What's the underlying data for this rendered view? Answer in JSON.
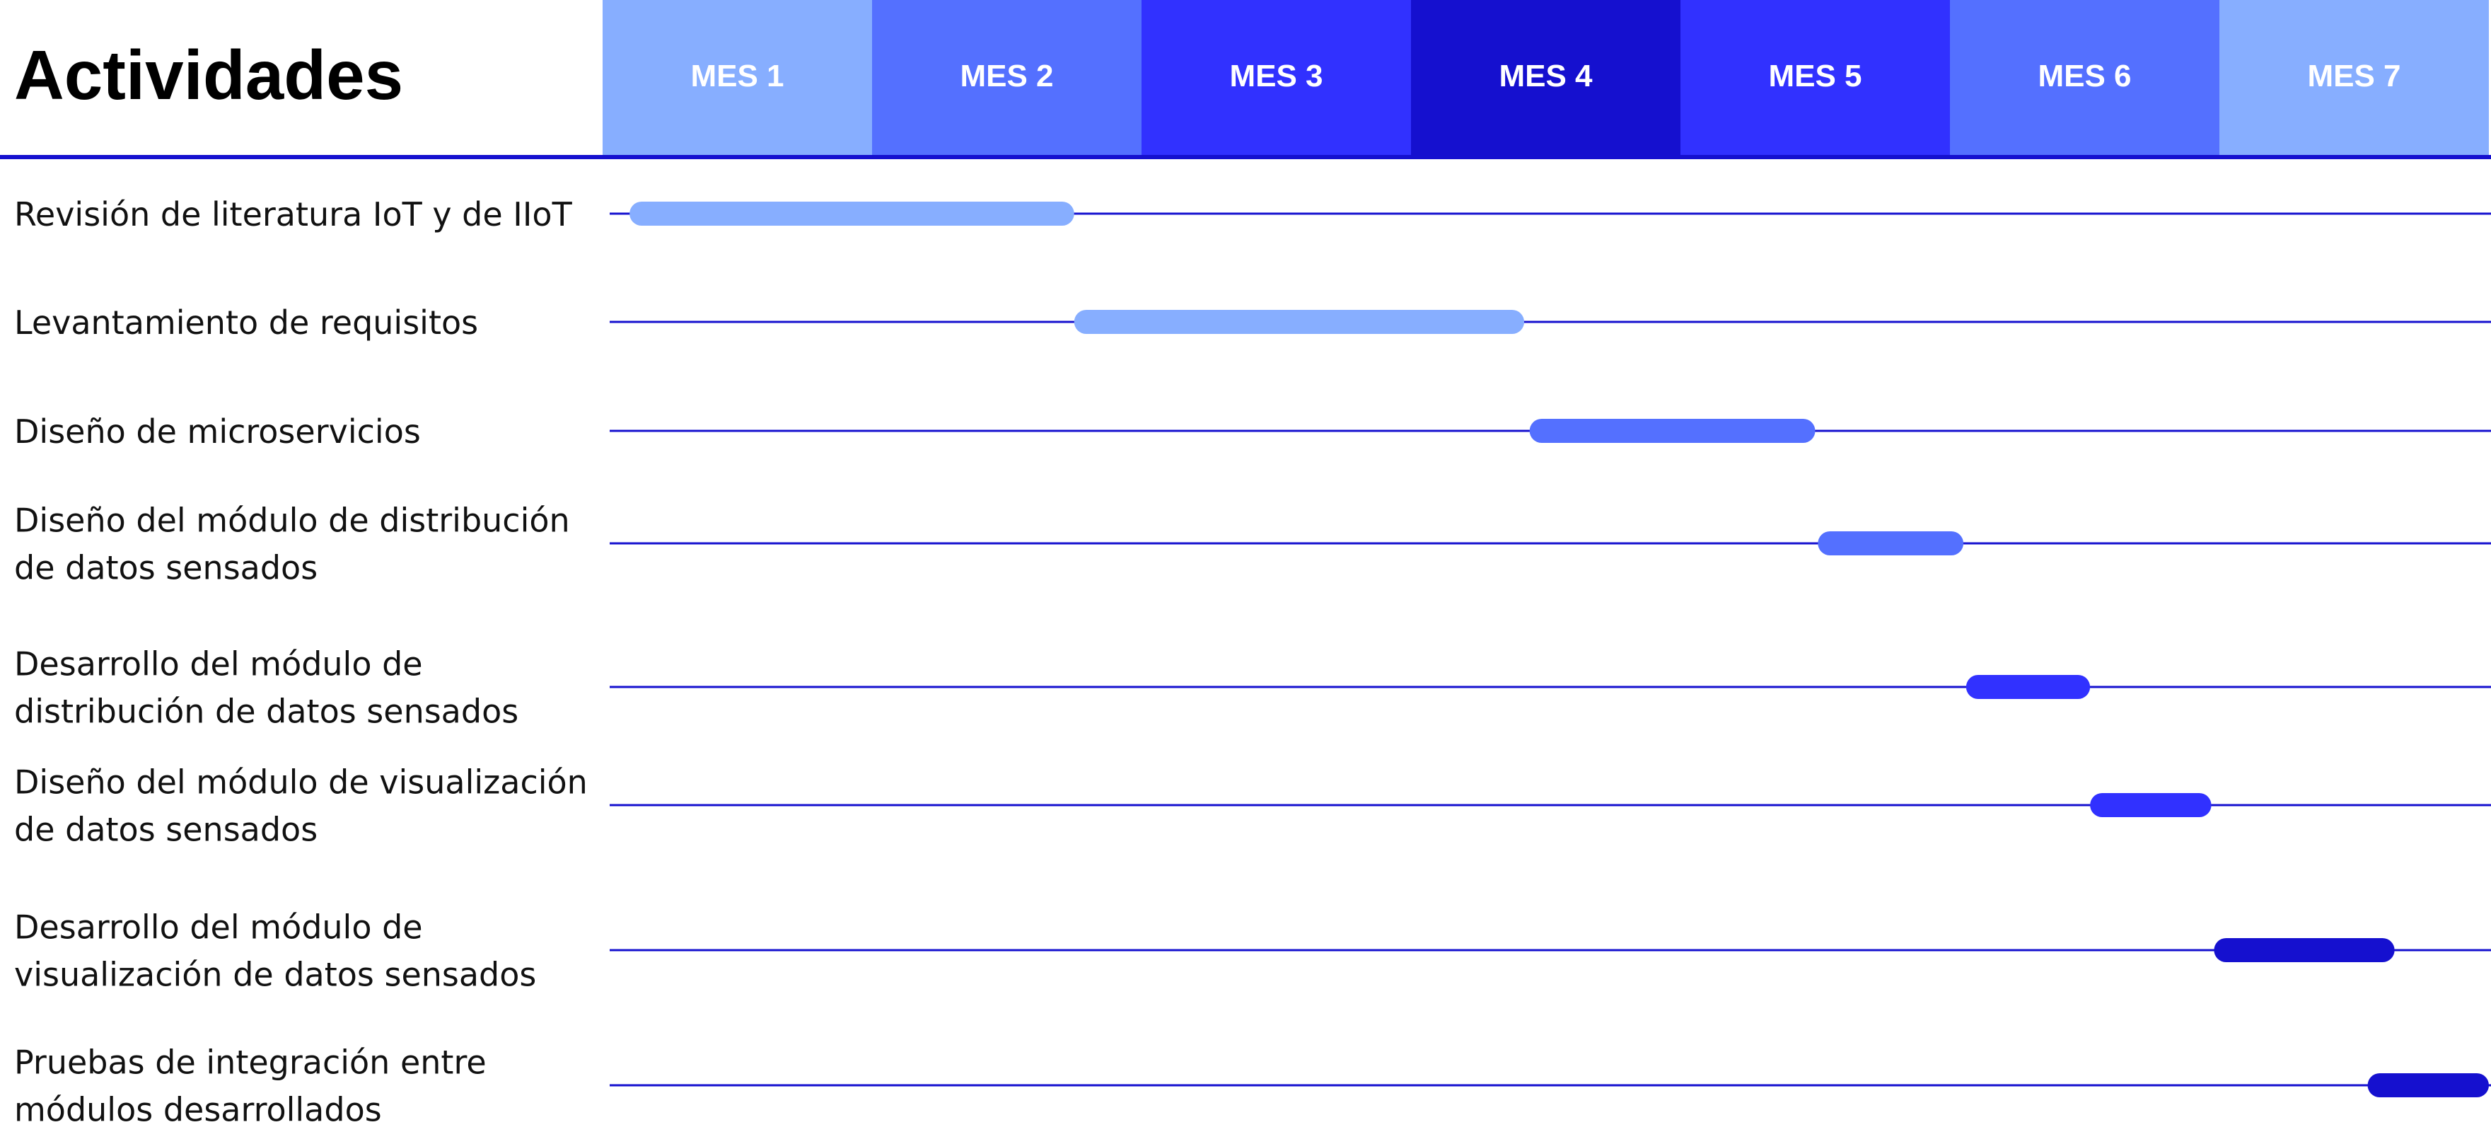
{
  "chart_data": {
    "type": "gantt",
    "title": "Actividades",
    "periods": [
      {
        "label": "MES 1",
        "color": "#87AEFF"
      },
      {
        "label": "MES 2",
        "color": "#5470FF"
      },
      {
        "label": "MES 3",
        "color": "#3131FF"
      },
      {
        "label": "MES 4",
        "color": "#1510CF"
      },
      {
        "label": "MES 5",
        "color": "#3131FF"
      },
      {
        "label": "MES 6",
        "color": "#5470FF"
      },
      {
        "label": "MES 7",
        "color": "#87AEFF"
      }
    ],
    "line_color": "#1510CF",
    "tasks": [
      {
        "lines": [
          "Revisión de literatura IoT y de IIoT"
        ],
        "start": 0.1,
        "end": 1.75,
        "color": "#87AEFF"
      },
      {
        "lines": [
          "Levantamiento de requisitos"
        ],
        "start": 1.75,
        "end": 3.42,
        "color": "#87AEFF"
      },
      {
        "lines": [
          "Diseño de microservicios"
        ],
        "start": 3.44,
        "end": 4.5,
        "color": "#5470FF"
      },
      {
        "lines": [
          "Diseño del módulo de distribución",
          "de datos sensados"
        ],
        "start": 4.51,
        "end": 5.05,
        "color": "#5470FF"
      },
      {
        "lines": [
          "Desarrollo del módulo de",
          "distribución de datos sensados"
        ],
        "start": 5.06,
        "end": 5.52,
        "color": "#3131FF"
      },
      {
        "lines": [
          "Diseño del módulo de visualización",
          "de datos sensados"
        ],
        "start": 5.52,
        "end": 5.97,
        "color": "#3131FF"
      },
      {
        "lines": [
          "Desarrollo del módulo de",
          "visualización de datos sensados"
        ],
        "start": 5.98,
        "end": 6.65,
        "color": "#1510CF"
      },
      {
        "lines": [
          "Pruebas de integración entre",
          "módulos desarrollados"
        ],
        "start": 6.55,
        "end": 7.0,
        "color": "#1510CF"
      }
    ]
  }
}
